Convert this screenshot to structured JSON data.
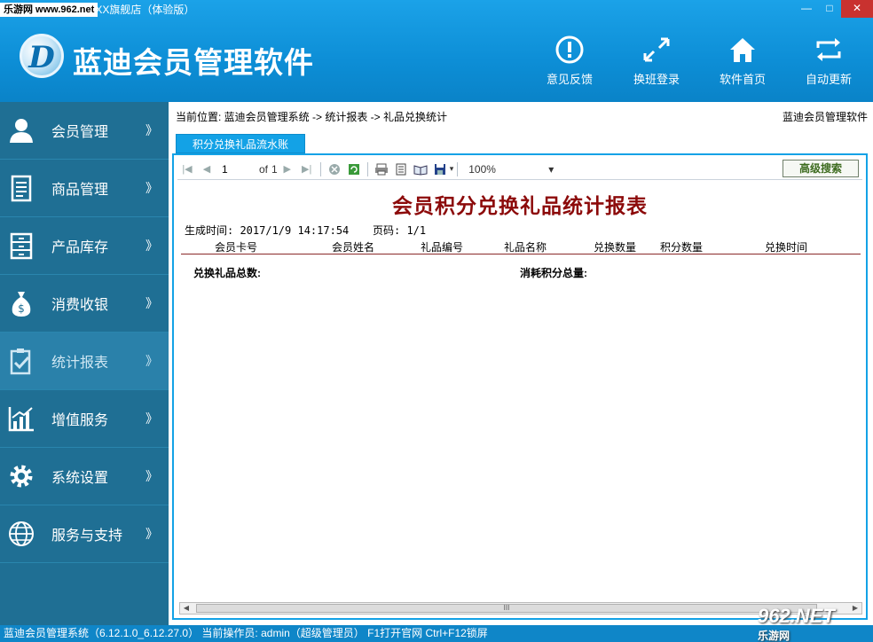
{
  "window": {
    "watermark_left": "乐游网 www.962.net",
    "title": "- XX旗舰店（体验版）",
    "min": "—",
    "max": "□",
    "close": "✕"
  },
  "header": {
    "app_title": "蓝迪会员管理软件",
    "logo_letter": "D",
    "buttons": [
      {
        "label": "意见反馈",
        "icon": "exclamation-icon"
      },
      {
        "label": "换班登录",
        "icon": "switch-arrows-icon"
      },
      {
        "label": "软件首页",
        "icon": "home-icon"
      },
      {
        "label": "自动更新",
        "icon": "refresh-icon"
      }
    ]
  },
  "sidebar": {
    "items": [
      {
        "label": "会员管理",
        "icon": "user-icon",
        "arrow": "》"
      },
      {
        "label": "商品管理",
        "icon": "document-icon",
        "arrow": "》"
      },
      {
        "label": "产品库存",
        "icon": "cabinet-icon",
        "arrow": "》"
      },
      {
        "label": "消费收银",
        "icon": "money-bag-icon",
        "arrow": "》"
      },
      {
        "label": "统计报表",
        "icon": "clipboard-icon",
        "arrow": "》",
        "active": true
      },
      {
        "label": "增值服务",
        "icon": "bar-chart-icon",
        "arrow": "》"
      },
      {
        "label": "系统设置",
        "icon": "gear-icon",
        "arrow": "》"
      },
      {
        "label": "服务与支持",
        "icon": "globe-icon",
        "arrow": "》"
      }
    ]
  },
  "content": {
    "breadcrumb": "当前位置: 蓝迪会员管理系统 -> 统计报表 -> 礼品兑换统计",
    "brand_right": "蓝迪会员管理软件",
    "tab": "积分兑换礼品流水账",
    "toolbar": {
      "page_value": "1",
      "of_label": "of",
      "total_pages": "1",
      "zoom": "100%",
      "zoom_arrow": "▾",
      "advanced_search": "高级搜索"
    },
    "report": {
      "title": "会员积分兑换礼品统计报表",
      "generated": "生成时间: 2017/1/9 14:17:54",
      "page": "页码: 1/1",
      "columns": [
        "会员卡号",
        "会员姓名",
        "礼品编号",
        "礼品名称",
        "兑换数量",
        "积分数量",
        "兑换时间"
      ],
      "summary_left": "兑换礼品总数:",
      "summary_right": "消耗积分总量:"
    },
    "scroll_grip": "III"
  },
  "statusbar": {
    "text": "蓝迪会员管理系统（6.12.1.0_6.12.27.0） 当前操作员: admin（超级管理员） F1打开官网 Ctrl+F12锁屏"
  },
  "watermark_right": {
    "top": "962.NET",
    "bottom": "乐游网"
  },
  "colors": {
    "header_blue": "#0d8ed6",
    "sidebar": "#1f6f94",
    "tab": "#13a2e6",
    "report_title": "#8c0a0a"
  }
}
